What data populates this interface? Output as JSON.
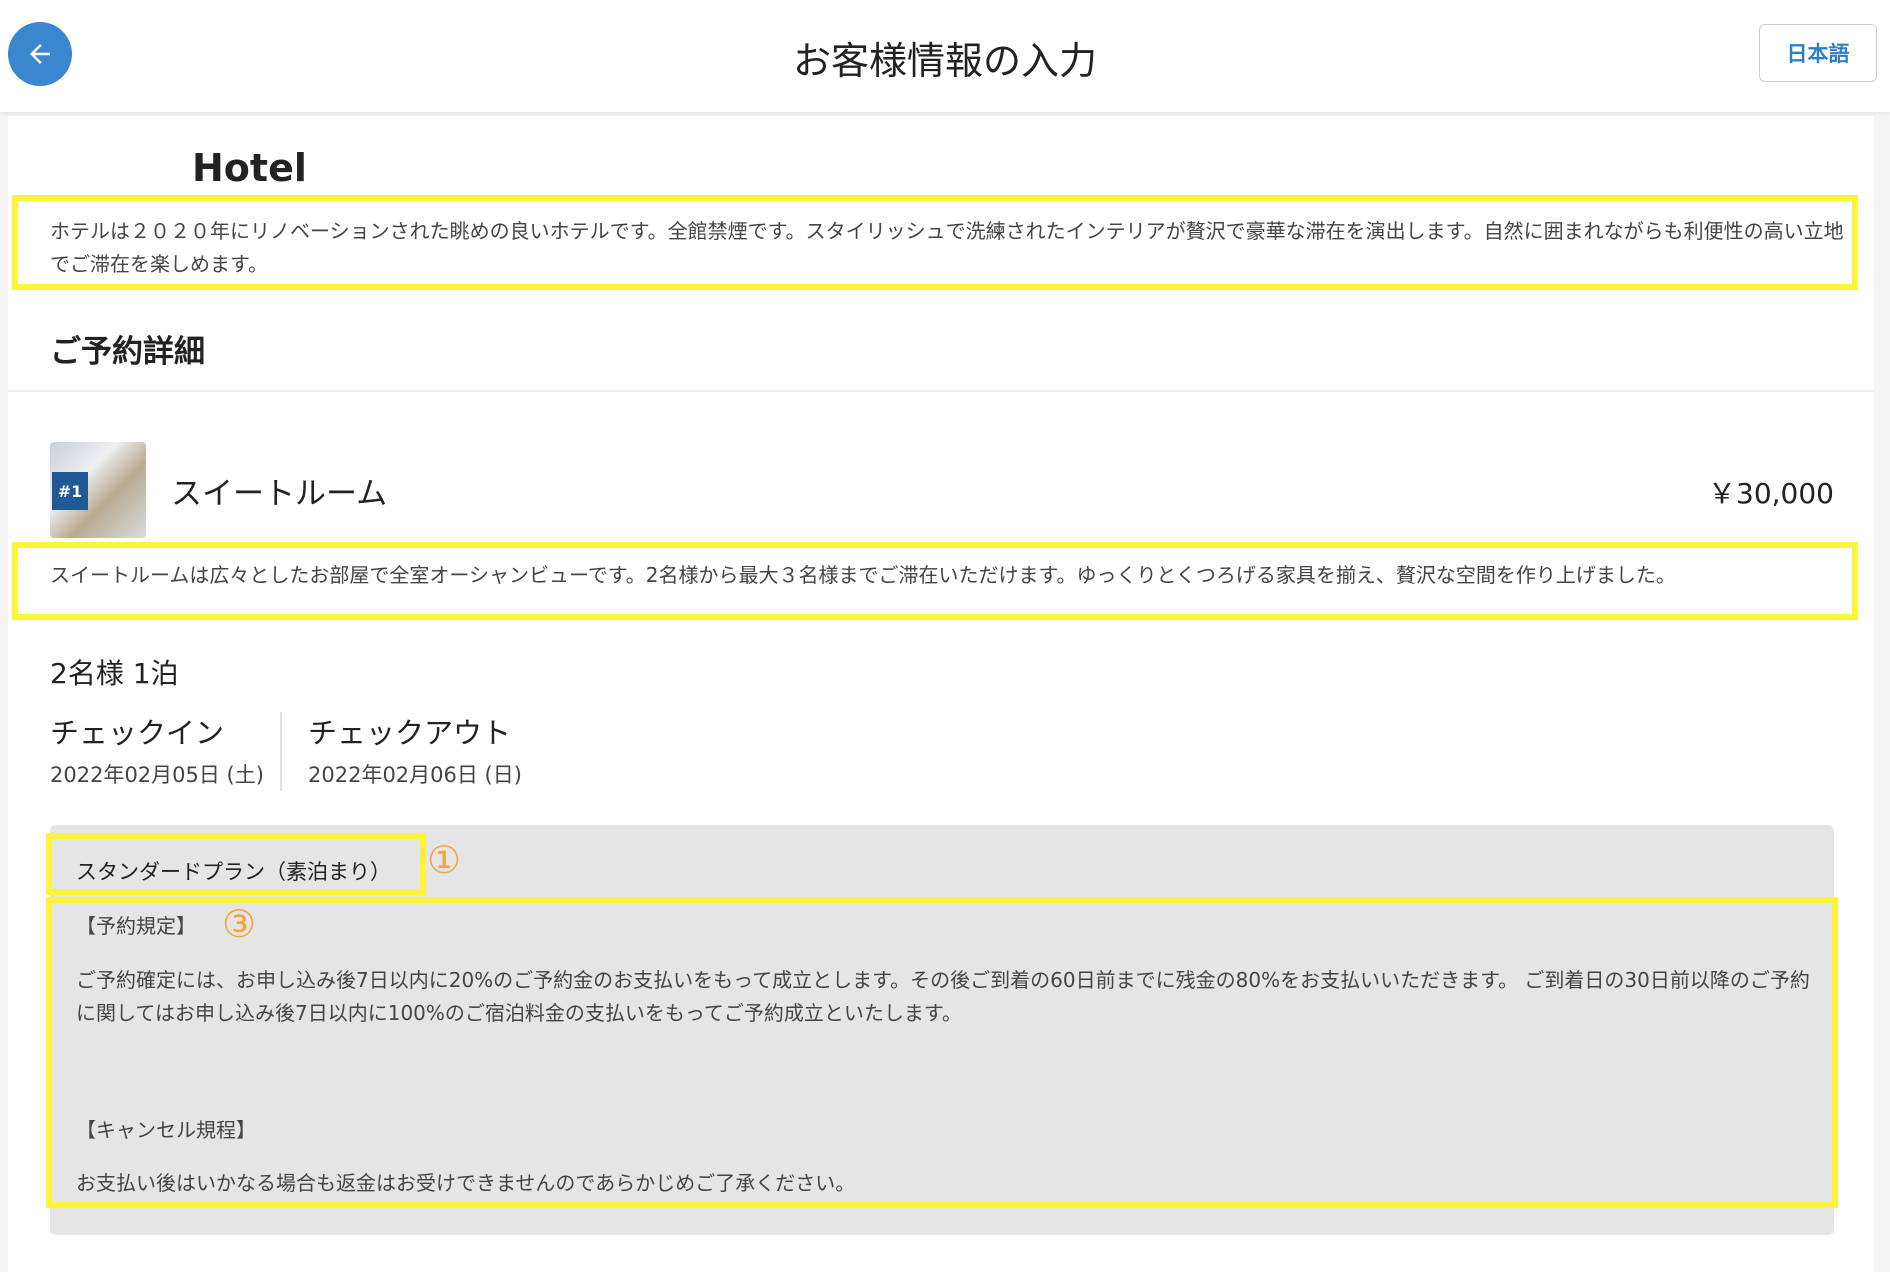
{
  "header": {
    "title": "お客様情報の入力",
    "language_label": "日本語"
  },
  "hotel": {
    "name": "Hotel",
    "description": "ホテルは２０２０年にリノベーションされた眺めの良いホテルです。全館禁煙です。スタイリッシュで洗練されたインテリアが贅沢で豪華な滞在を演出します。自然に囲まれながらも利便性の高い立地でご滞在を楽しめます。"
  },
  "reservation": {
    "section_title": "ご予約詳細",
    "room": {
      "badge": "#1",
      "name": "スイートルーム",
      "price": "￥30,000",
      "description": "スイートルームは広々としたお部屋で全室オーシャンビューです。2名様から最大３名様までご滞在いただけます。ゆっくりとくつろげる家具を揃え、贅沢な空間を作り上げました。"
    },
    "guests_nights": "2名様 1泊",
    "checkin": {
      "label": "チェックイン",
      "date": "2022年02月05日 (土)"
    },
    "checkout": {
      "label": "チェックアウト",
      "date": "2022年02月06日 (日)"
    }
  },
  "plan": {
    "name": "スタンダードプラン（素泊まり）",
    "marker_1": "①",
    "marker_3": "③",
    "rules_heading": "【予約規定】",
    "rules_text": "ご予約確定には、お申し込み後7日以内に20%のご予約金のお支払いをもって成立とします。その後ご到着の60日前までに残金の80%をお支払いいただきます。 ご到着日の30日前以降のご予約に関してはお申し込み後7日以内に100%のご宿泊料金の支払いをもってご予約成立といたします。",
    "cancel_heading": "【キャンセル規程】",
    "cancel_text": "お支払い後はいかなる場合も返金はお受けできませんのであらかじめご了承ください。"
  },
  "colors": {
    "accent": "#3a87cf",
    "highlight": "#fcf43a",
    "marker": "#f4a33d",
    "plan_background": "#e5e5e5"
  }
}
